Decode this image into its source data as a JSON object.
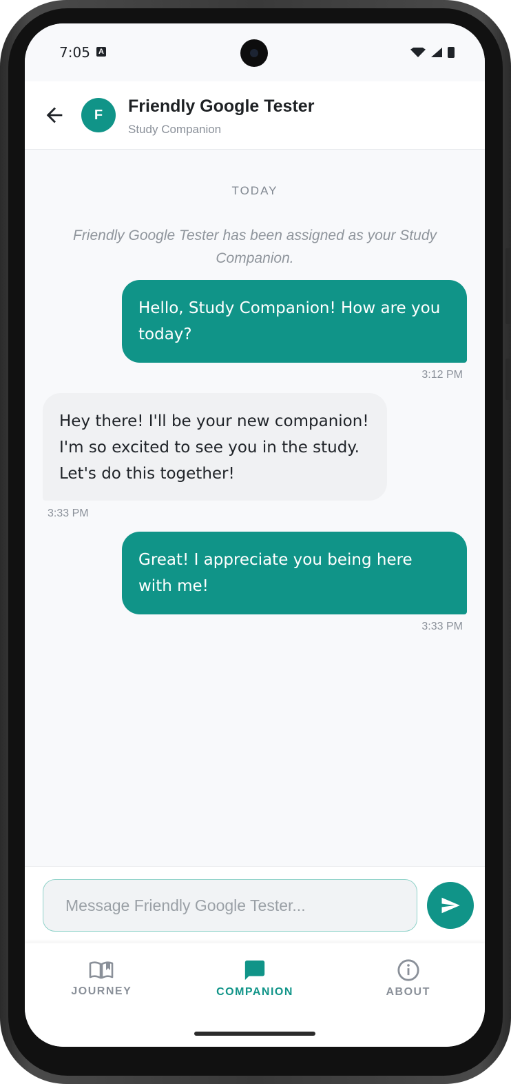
{
  "status_bar": {
    "time": "7:05",
    "keyboard_badge": "A",
    "icons": [
      "wifi-icon",
      "signal-icon",
      "battery-icon"
    ]
  },
  "header": {
    "back_icon": "arrow-left-icon",
    "avatar_initial": "F",
    "name": "Friendly Google Tester",
    "subtitle": "Study Companion"
  },
  "conversation": {
    "date_divider": "TODAY",
    "system_message": "Friendly Google Tester has been assigned as your Study Companion.",
    "messages": [
      {
        "direction": "outgoing",
        "text": "Hello, Study Companion!  How are you today?",
        "time": "3:12 PM"
      },
      {
        "direction": "incoming",
        "text": "Hey there!  I'll be your new companion!  I'm so excited to see you in the study.  Let's do this together!",
        "time": "3:33 PM"
      },
      {
        "direction": "outgoing",
        "text": "Great!  I appreciate you being here with me!",
        "time": "3:33 PM"
      }
    ]
  },
  "composer": {
    "placeholder": "Message Friendly Google Tester...",
    "value": "",
    "send_icon": "send-icon"
  },
  "bottom_nav": {
    "items": [
      {
        "label": "JOURNEY",
        "icon": "book-icon",
        "active": false
      },
      {
        "label": "COMPANION",
        "icon": "chat-icon",
        "active": true
      },
      {
        "label": "ABOUT",
        "icon": "info-icon",
        "active": false
      }
    ]
  },
  "colors": {
    "accent": "#109488",
    "incoming_bubble": "#f0f1f3",
    "background": "#f8f9fb",
    "muted_text": "#8a9099"
  }
}
